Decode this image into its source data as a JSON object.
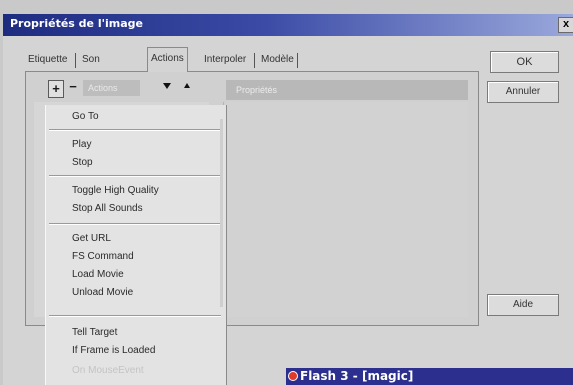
{
  "window": {
    "title": "Propriétés de l'image",
    "close_label": "x"
  },
  "tabs": [
    {
      "label": "Etiquette"
    },
    {
      "label": "Son"
    },
    {
      "label": "Actions"
    },
    {
      "label": "Interpoler"
    },
    {
      "label": "Modèle"
    }
  ],
  "active_tab": "Actions",
  "toolbar": {
    "add_label": "+",
    "remove_label": "−",
    "actions_field": "Actions"
  },
  "properties_header": "Propriétés",
  "buttons": {
    "ok": "OK",
    "cancel": "Annuler",
    "help": "Aide"
  },
  "menu": {
    "items": [
      {
        "label": "Go To"
      },
      {
        "label": "Play"
      },
      {
        "label": "Stop"
      },
      {
        "label": "Toggle High Quality"
      },
      {
        "label": "Stop All Sounds"
      },
      {
        "label": "Get URL"
      },
      {
        "label": "FS Command"
      },
      {
        "label": "Load Movie"
      },
      {
        "label": "Unload Movie"
      },
      {
        "label": "Tell Target"
      },
      {
        "label": "If Frame is Loaded"
      },
      {
        "label": "On MouseEvent"
      }
    ]
  },
  "taskbar": {
    "label": "Flash 3 - [magic]",
    "accent": "#2c2f8e"
  }
}
